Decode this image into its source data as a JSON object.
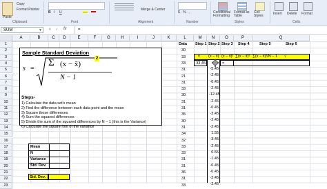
{
  "ribbon": {
    "paste": "Paste",
    "copy": "Copy",
    "format_painter": "Format Painter",
    "clipboard": "Clipboard",
    "font": "Font",
    "alignment": "Alignment",
    "merge_center": "Merge & Center",
    "number": "Number",
    "conditional_formatting": "Conditional Formatting",
    "format_as_table": "Format as Table",
    "cell_styles": "Cell Styles",
    "styles": "Styles",
    "insert": "Insert",
    "delete": "Delete",
    "format": "Format",
    "cells": "Cells"
  },
  "formula_bar": {
    "name_box": "SUM",
    "fx": "fx",
    "formula": "="
  },
  "columns": [
    "A",
    "B",
    "C",
    "D",
    "E",
    "F",
    "G",
    "H",
    "I",
    "J",
    "K",
    "L",
    "M",
    "N",
    "O",
    "P",
    "Q"
  ],
  "row_numbers_left": [
    "1",
    "2",
    "3",
    "4",
    "5",
    "6",
    "7",
    "8",
    "9",
    "10",
    "11",
    "12",
    "13",
    "14",
    "15",
    "16",
    "17",
    "18",
    "19",
    "20",
    "21",
    "22",
    "23"
  ],
  "row_numbers_right": [
    "39",
    "30",
    "33",
    "33",
    "31",
    "21",
    "31",
    "33",
    "30",
    "31",
    "31",
    "35",
    "30",
    "31",
    "34",
    "32",
    "33",
    "33",
    "31",
    "31",
    "36",
    "31",
    "33"
  ],
  "formula_box": {
    "title": "Sample Standard Deviation",
    "s": "s",
    "equals": "=",
    "sigma": "Σ",
    "x": "(x − x̄)",
    "exp": "2",
    "denom": "N − 1"
  },
  "steps": {
    "heading": "Steps-",
    "items": [
      "1)  Calculate the data set's mean",
      "2)  Find the difference between each data point and the mean",
      "3)  Square those differences",
      "4)  Sum the squared differences",
      "5)  Divide the sum of the squared differences by N − 1 (this is the Variance)",
      "6)  Calculate the square root of the variance"
    ]
  },
  "stats_labels": [
    "Mean",
    "N",
    "Variance",
    "Std. Dev."
  ],
  "std_dev_label": "Std. Dev.",
  "data_header": "Data",
  "step_headers": [
    "Step 1",
    "Step 2",
    "Step 3",
    "Step 4",
    "Step 5",
    "Step 6"
  ],
  "formula_headers": [
    "x̄",
    "(x − x̄)",
    "(x − x̄)²",
    "∑(x − x̄)²",
    "∑(x − x̄)²/N − 1",
    "√‾‾"
  ],
  "step1_value": "33.45",
  "step2_values": [
    "-5.45",
    "-2.45",
    "-0.45",
    "-2.45",
    "-12.45",
    "-2.45",
    "-0.45",
    "-3.45",
    "-2.45",
    "-2.45",
    "1.55",
    "-3.45",
    "-2.45",
    "0.55",
    "-1.45",
    "-0.45",
    "-0.45",
    "-2.45",
    "-2.45"
  ],
  "active_cell_value": "="
}
